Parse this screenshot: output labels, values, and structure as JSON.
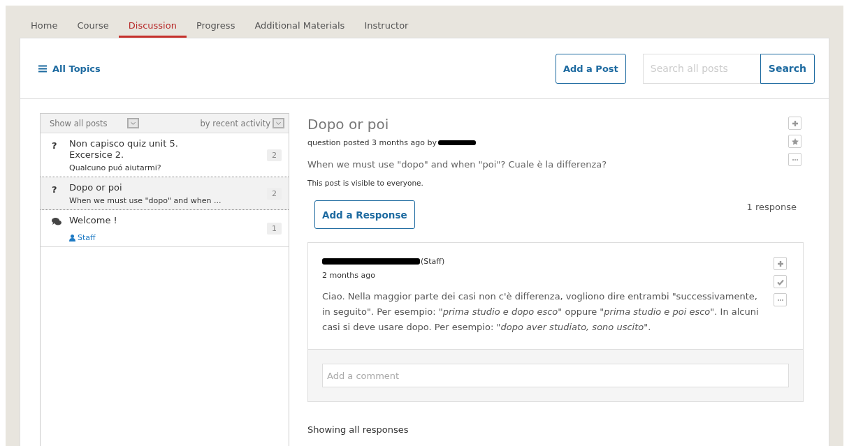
{
  "nav_tabs": [
    {
      "label": "Home",
      "selected": false
    },
    {
      "label": "Course",
      "selected": false
    },
    {
      "label": "Discussion",
      "selected": true
    },
    {
      "label": "Progress",
      "selected": false
    },
    {
      "label": "Additional Materials",
      "selected": false
    },
    {
      "label": "Instructor",
      "selected": false
    }
  ],
  "header": {
    "topics_label": "All Topics",
    "add_post": "Add a Post",
    "search": {
      "placeholder": "Search all posts",
      "button": "Search"
    }
  },
  "sidebar": {
    "filter": "Show all posts",
    "sort": "by recent activity",
    "threads": [
      {
        "kind": "question",
        "icon": "?",
        "title": "Non capisco quiz unit 5. Excersice 2.",
        "preview": "Qualcuno puó aiutarmi?",
        "count": "2",
        "selected": false
      },
      {
        "kind": "question",
        "icon": "?",
        "title": "Dopo or poi",
        "preview": "When we must use \"dopo\" and when ...",
        "count": "2",
        "selected": true
      },
      {
        "kind": "discussion",
        "title": "Welcome !",
        "author_label": "Staff",
        "count": "1",
        "selected": false
      }
    ]
  },
  "post": {
    "title": "Dopo or poi",
    "meta": "question posted 3 months ago by",
    "body": "When we must use \"dopo\" and when \"poi\"? Cuale è la differenza?",
    "visibility": "This post is visible to everyone.",
    "add_response": "Add a Response",
    "response_count": "1 response"
  },
  "responses": [
    {
      "role": "(Staff)",
      "time": "2 months ago",
      "body": "Ciao. Nella maggior parte dei casi non c'è differenza, vogliono dire entrambi \"successivamente, in seguito\". Per esempio: \"*prima studio e dopo esco*\" oppure \"*prima studio e poi esco*\". In alcuni casi si deve usare dopo. Per esempio: \"*dopo aver studiato, sono uscito*\".",
      "comment_placeholder": "Add a comment"
    }
  ],
  "footer_text": "Showing all responses"
}
